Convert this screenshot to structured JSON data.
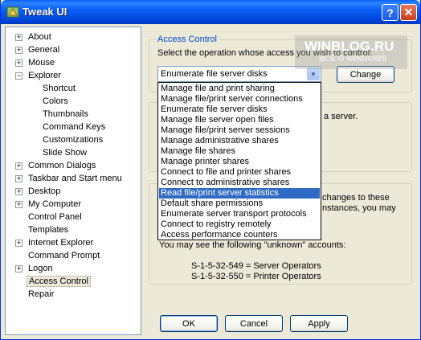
{
  "window": {
    "title": "Tweak UI",
    "help_glyph": "?",
    "close_glyph": "✕"
  },
  "tree": {
    "items": [
      {
        "label": "About",
        "expander": "+"
      },
      {
        "label": "General",
        "expander": "+"
      },
      {
        "label": "Mouse",
        "expander": "+"
      },
      {
        "label": "Explorer",
        "expander": "−"
      },
      {
        "label": "Shortcut"
      },
      {
        "label": "Colors"
      },
      {
        "label": "Thumbnails"
      },
      {
        "label": "Command Keys"
      },
      {
        "label": "Customizations"
      },
      {
        "label": "Slide Show"
      },
      {
        "label": "Common Dialogs",
        "expander": "+"
      },
      {
        "label": "Taskbar and Start menu",
        "expander": "+"
      },
      {
        "label": "Desktop",
        "expander": "+"
      },
      {
        "label": "My Computer",
        "expander": "+"
      },
      {
        "label": "Control Panel"
      },
      {
        "label": "Templates"
      },
      {
        "label": "Internet Explorer",
        "expander": "+"
      },
      {
        "label": "Command Prompt"
      },
      {
        "label": "Logon",
        "expander": "+"
      },
      {
        "label": "Access Control"
      },
      {
        "label": "Repair"
      }
    ]
  },
  "access_control": {
    "group_title": "Access Control",
    "instruction": "Select the operation whose access you wish to control:",
    "selected_operation": "Enumerate file server disks",
    "change_label": "Change",
    "dropdown_options": [
      "Manage file and print sharing",
      "Manage file/print server connections",
      "Enumerate file server disks",
      "Manage file server open files",
      "Manage file/print server sessions",
      "Manage administrative shares",
      "Manage file shares",
      "Manage printer shares",
      "Connect to file and printer shares",
      "Connect to administrative shares",
      "Read file/print server statistics",
      "Default share permissions",
      "Enumerate server transport protocols",
      "Connect to registry remotely",
      "Access performance counters"
    ],
    "highlighted_option": "Read file/print server statistics",
    "partial_text_1": "a server.",
    "partial_text_2": "changes to these",
    "partial_text_3": "nstances, you may",
    "unknown_note": "You may see the following \"unknown\" accounts:",
    "account_1": "S-1-5-32-549 = Server Operators",
    "account_2": "S-1-5-32-550 = Printer Operators"
  },
  "buttons": {
    "ok": "OK",
    "cancel": "Cancel",
    "apply": "Apply"
  },
  "watermark": {
    "line1": "WINBLOG.RU",
    "line2": "ВСЁ О WINDOWS"
  }
}
